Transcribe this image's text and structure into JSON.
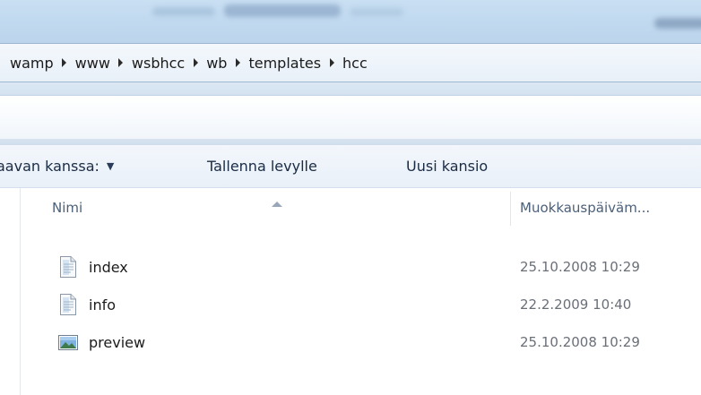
{
  "breadcrumb": {
    "items": [
      "wamp",
      "www",
      "wsbhcc",
      "wb",
      "templates",
      "hcc"
    ]
  },
  "toolbar": {
    "share_label": "aavan kanssa:",
    "share_caret": "▼",
    "burn_label": "Tallenna levylle",
    "new_folder_label": "Uusi kansio"
  },
  "columns": {
    "name": "Nimi",
    "date_modified": "Muokkauspäiväm..."
  },
  "files": [
    {
      "name": "index",
      "date": "25.10.2008 10:29",
      "icon": "text-file-icon"
    },
    {
      "name": "info",
      "date": "22.2.2009 10:40",
      "icon": "text-file-icon"
    },
    {
      "name": "preview",
      "date": "25.10.2008 10:29",
      "icon": "image-file-icon"
    }
  ],
  "colors": {
    "accent": "#c2daf0",
    "text": "#1c1c1c",
    "date_text": "#6a6f78",
    "header_text": "#4c607a"
  }
}
